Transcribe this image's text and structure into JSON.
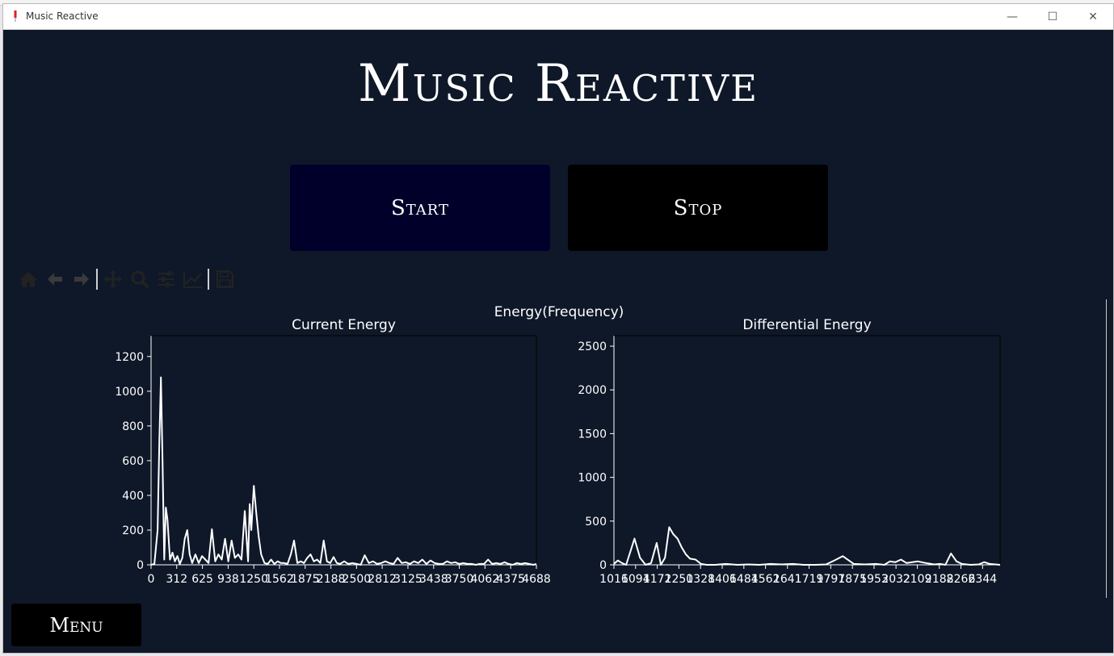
{
  "window": {
    "title": "Music Reactive",
    "minimize_glyph": "—",
    "maximize_glyph": "☐",
    "close_glyph": "✕"
  },
  "main": {
    "title": "Music Reactive",
    "start_label": "Start",
    "stop_label": "Stop",
    "menu_label": "Menu"
  },
  "toolbar": {
    "icons": [
      "home-icon",
      "back-icon",
      "forward-icon",
      "pan-icon",
      "zoom-icon",
      "configure-subplots-icon",
      "edit-axis-icon",
      "save-icon"
    ]
  },
  "colors": {
    "background": "#0f1829",
    "line": "#ffffff",
    "start_button": "#00002a",
    "stop_button": "#000000"
  },
  "figure": {
    "suptitle": "Energy(Frequency)"
  },
  "chart_data": [
    {
      "type": "line",
      "title": "Current Energy",
      "xlabel": "",
      "ylabel": "",
      "xlim": [
        0,
        4688
      ],
      "ylim": [
        0,
        1320
      ],
      "xticks": [
        0,
        312,
        625,
        938,
        1250,
        1562,
        1875,
        2188,
        2500,
        2812,
        3125,
        3438,
        3750,
        4062,
        4375,
        4688
      ],
      "xtick_labels": [
        "0",
        "312",
        "625",
        "938",
        "1250",
        "1562",
        "1875",
        "2188",
        "2500",
        "2812",
        "3125",
        "3438",
        "3750",
        "4062",
        "4375",
        "4688"
      ],
      "yticks": [
        0,
        200,
        400,
        600,
        800,
        1000,
        1200
      ],
      "ytick_labels": [
        "0",
        "200",
        "400",
        "600",
        "800",
        "1000",
        "1200"
      ],
      "series": [
        {
          "x": [
            0,
            40,
            80,
            100,
            120,
            140,
            160,
            180,
            200,
            230,
            260,
            290,
            320,
            350,
            380,
            410,
            440,
            470,
            500,
            540,
            580,
            620,
            660,
            700,
            740,
            780,
            820,
            860,
            900,
            940,
            980,
            1020,
            1060,
            1100,
            1140,
            1180,
            1200,
            1220,
            1250,
            1280,
            1310,
            1340,
            1380,
            1420,
            1460,
            1500,
            1540,
            1580,
            1620,
            1660,
            1700,
            1740,
            1780,
            1820,
            1860,
            1900,
            1940,
            1980,
            2020,
            2060,
            2100,
            2140,
            2180,
            2220,
            2260,
            2300,
            2350,
            2400,
            2450,
            2500,
            2550,
            2600,
            2650,
            2700,
            2750,
            2800,
            2850,
            2900,
            2950,
            3000,
            3050,
            3100,
            3150,
            3200,
            3250,
            3300,
            3350,
            3400,
            3450,
            3500,
            3550,
            3600,
            3650,
            3700,
            3750,
            3800,
            3850,
            3900,
            3950,
            4000,
            4050,
            4100,
            4150,
            4200,
            4250,
            4300,
            4350,
            4400,
            4450,
            4500,
            4550,
            4600,
            4650,
            4688
          ],
          "y": [
            0,
            5,
            200,
            700,
            1080,
            600,
            30,
            330,
            260,
            30,
            70,
            20,
            50,
            5,
            40,
            150,
            200,
            60,
            10,
            60,
            10,
            50,
            30,
            10,
            205,
            20,
            60,
            30,
            150,
            20,
            140,
            40,
            60,
            30,
            310,
            20,
            350,
            200,
            455,
            300,
            160,
            60,
            10,
            5,
            30,
            5,
            20,
            10,
            10,
            5,
            60,
            140,
            10,
            20,
            10,
            40,
            60,
            20,
            30,
            10,
            140,
            20,
            10,
            45,
            10,
            5,
            20,
            5,
            10,
            5,
            0,
            55,
            10,
            20,
            5,
            10,
            20,
            10,
            5,
            40,
            10,
            15,
            5,
            20,
            10,
            30,
            5,
            25,
            10,
            5,
            5,
            20,
            10,
            15,
            5,
            10,
            5,
            5,
            0,
            5,
            5,
            30,
            5,
            10,
            5,
            15,
            5,
            0,
            10,
            5,
            10,
            5,
            0,
            5
          ]
        }
      ]
    },
    {
      "type": "line",
      "title": "Differential Energy",
      "xlabel": "",
      "ylabel": "",
      "xlim": [
        1016,
        2407
      ],
      "ylim": [
        0,
        2620
      ],
      "xticks": [
        1016,
        1094,
        1172,
        1250,
        1328,
        1406,
        1484,
        1562,
        1641,
        1719,
        1797,
        1875,
        1953,
        2032,
        2109,
        2188,
        2266,
        2344
      ],
      "xtick_labels": [
        "1016",
        "1094",
        "1172",
        "1250",
        "1328",
        "1406",
        "1484",
        "1562",
        "1641",
        "1719",
        "1797",
        "1875",
        "1953",
        "2032",
        "2109",
        "2188",
        "2266",
        "2344"
      ],
      "yticks": [
        0,
        500,
        1000,
        1500,
        2000,
        2500
      ],
      "ytick_labels": [
        "0",
        "500",
        "1000",
        "1500",
        "2000",
        "2500"
      ],
      "series": [
        {
          "x": [
            1016,
            1030,
            1045,
            1060,
            1075,
            1090,
            1110,
            1130,
            1150,
            1170,
            1185,
            1200,
            1215,
            1230,
            1245,
            1260,
            1275,
            1290,
            1310,
            1330,
            1350,
            1380,
            1420,
            1460,
            1500,
            1540,
            1580,
            1620,
            1660,
            1700,
            1740,
            1780,
            1810,
            1840,
            1880,
            1920,
            1960,
            1990,
            2010,
            2030,
            2050,
            2070,
            2090,
            2110,
            2140,
            2170,
            2190,
            2210,
            2230,
            2250,
            2270,
            2300,
            2330,
            2350,
            2370,
            2407
          ],
          "y": [
            10,
            50,
            20,
            0,
            150,
            300,
            80,
            0,
            20,
            250,
            0,
            80,
            430,
            350,
            300,
            200,
            120,
            70,
            60,
            10,
            0,
            0,
            10,
            0,
            5,
            0,
            10,
            5,
            10,
            0,
            0,
            5,
            50,
            100,
            10,
            5,
            10,
            0,
            40,
            30,
            60,
            20,
            30,
            40,
            20,
            5,
            10,
            0,
            130,
            40,
            10,
            0,
            5,
            30,
            10,
            0
          ]
        }
      ]
    }
  ]
}
